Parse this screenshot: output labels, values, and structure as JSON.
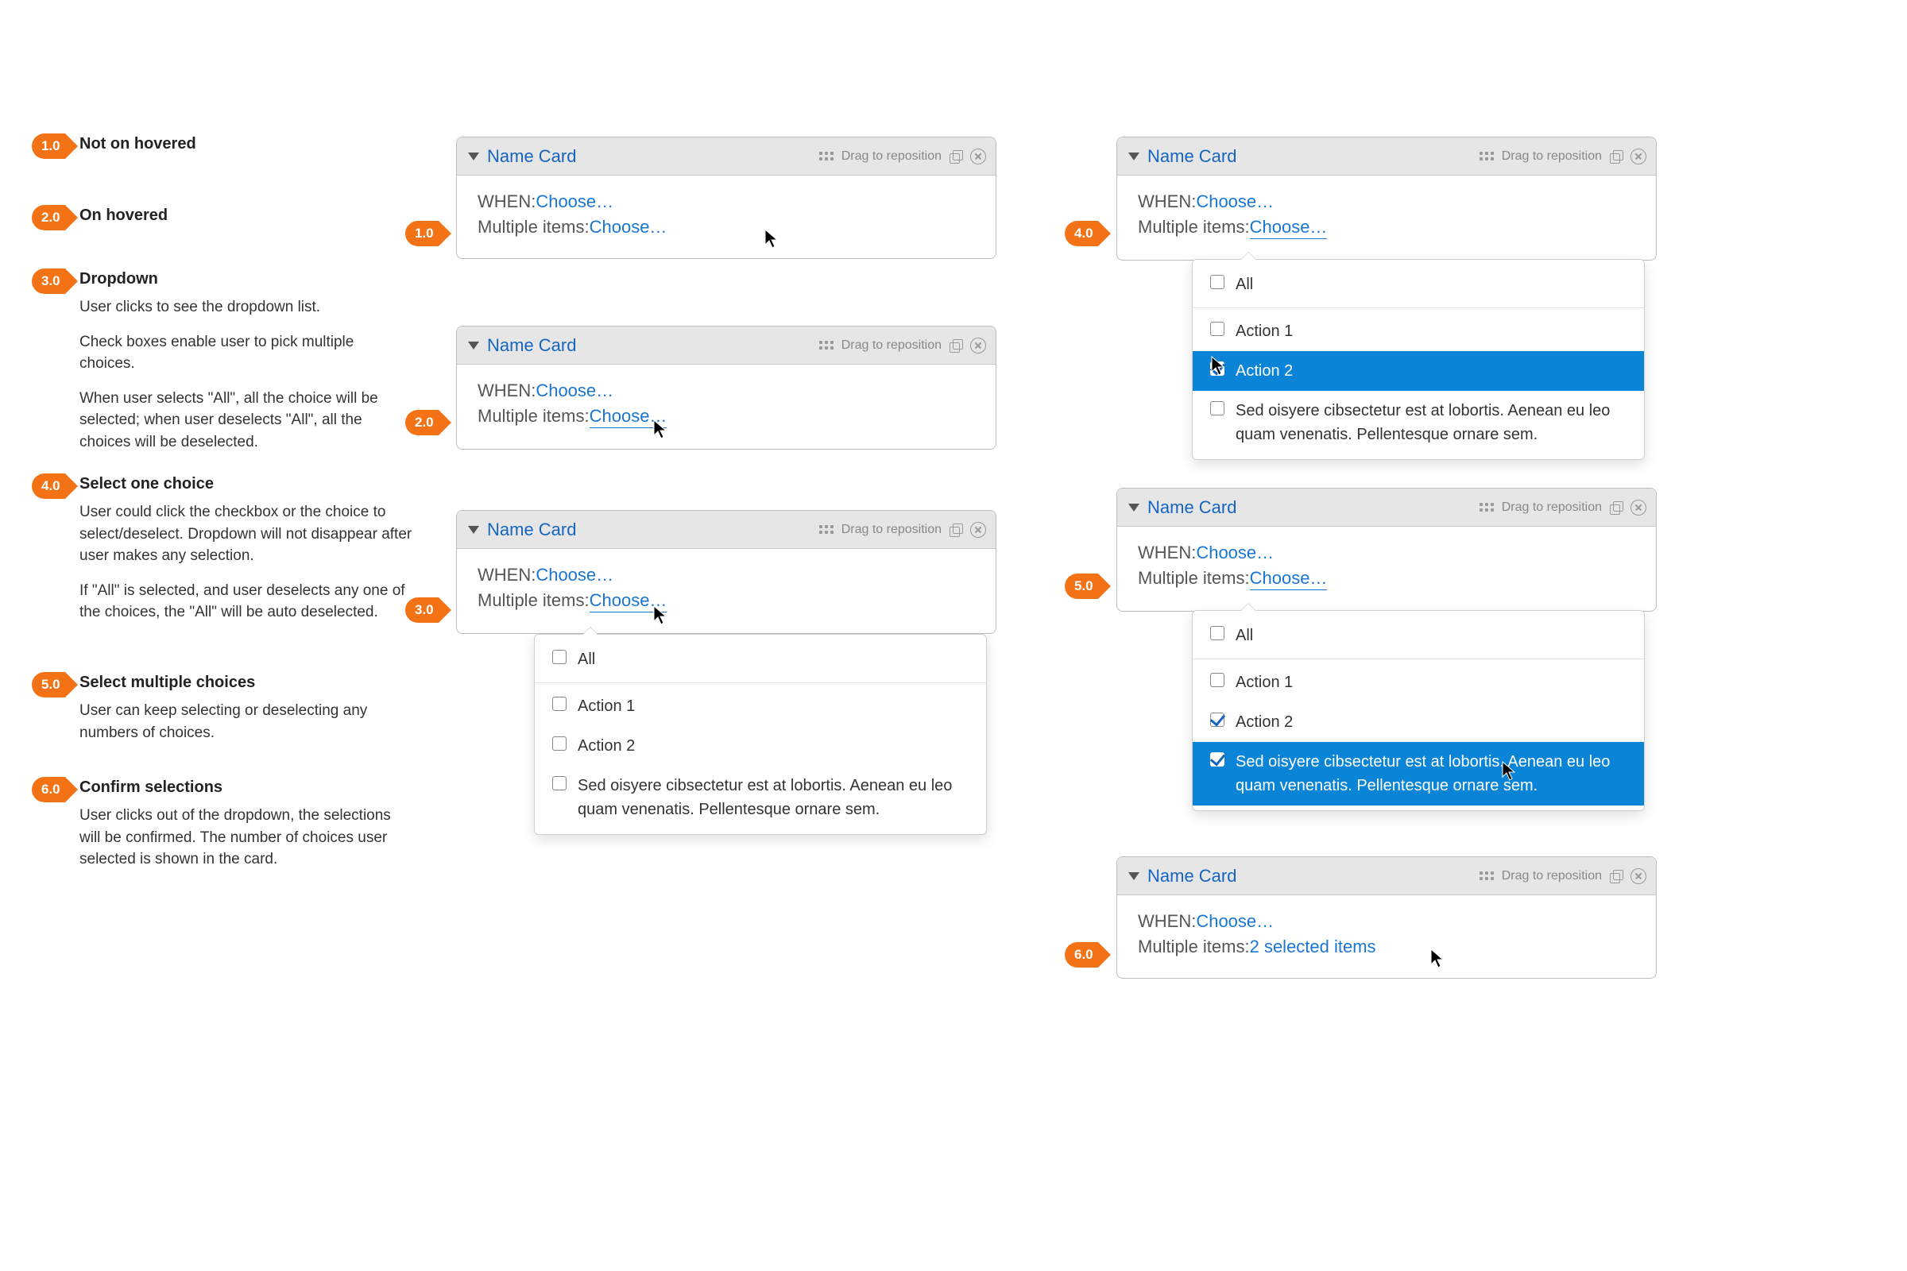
{
  "colors": {
    "accent": "#f47216",
    "link": "#1976d2",
    "select": "#0a84d6"
  },
  "legend": [
    {
      "num": "1.0",
      "title": "Not on hovered",
      "paras": []
    },
    {
      "num": "2.0",
      "title": "On hovered",
      "paras": []
    },
    {
      "num": "3.0",
      "title": "Dropdown",
      "paras": [
        "User clicks to see the dropdown list.",
        "Check boxes enable user to pick multiple choices.",
        "When user selects \"All\", all the choice will be selected; when user deselects \"All\", all the choices will be deselected."
      ]
    },
    {
      "num": "4.0",
      "title": "Select one choice",
      "paras": [
        "User could click the checkbox or the choice to select/deselect. Dropdown will not disappear after user makes any selection.",
        "If \"All\" is selected, and user deselects any one of the choices, the \"All\" will be auto deselected."
      ]
    },
    {
      "num": "5.0",
      "title": "Select multiple choices",
      "paras": [
        "User can keep selecting or deselecting any numbers of choices."
      ]
    },
    {
      "num": "6.0",
      "title": "Confirm selections",
      "paras": [
        "User clicks out of the dropdown, the selections will be confirmed. The number of choices user selected is shown in the card."
      ]
    }
  ],
  "markers": {
    "m1": "1.0",
    "m2": "2.0",
    "m3": "3.0",
    "m4": "4.0",
    "m5": "5.0",
    "m6": "6.0"
  },
  "card": {
    "title": "Name Card",
    "drag_label": "Drag to reposition",
    "when_label": "WHEN:",
    "multi_label": "Multiple items:",
    "choose": "Choose…",
    "selected_summary": "2 selected items"
  },
  "dd": {
    "all": "All",
    "opt1": "Action 1",
    "opt2": "Action 2",
    "opt3": "Sed oisyere cibsectetur est at lobortis. Aenean eu leo quam venenatis. Pellentesque ornare sem."
  }
}
